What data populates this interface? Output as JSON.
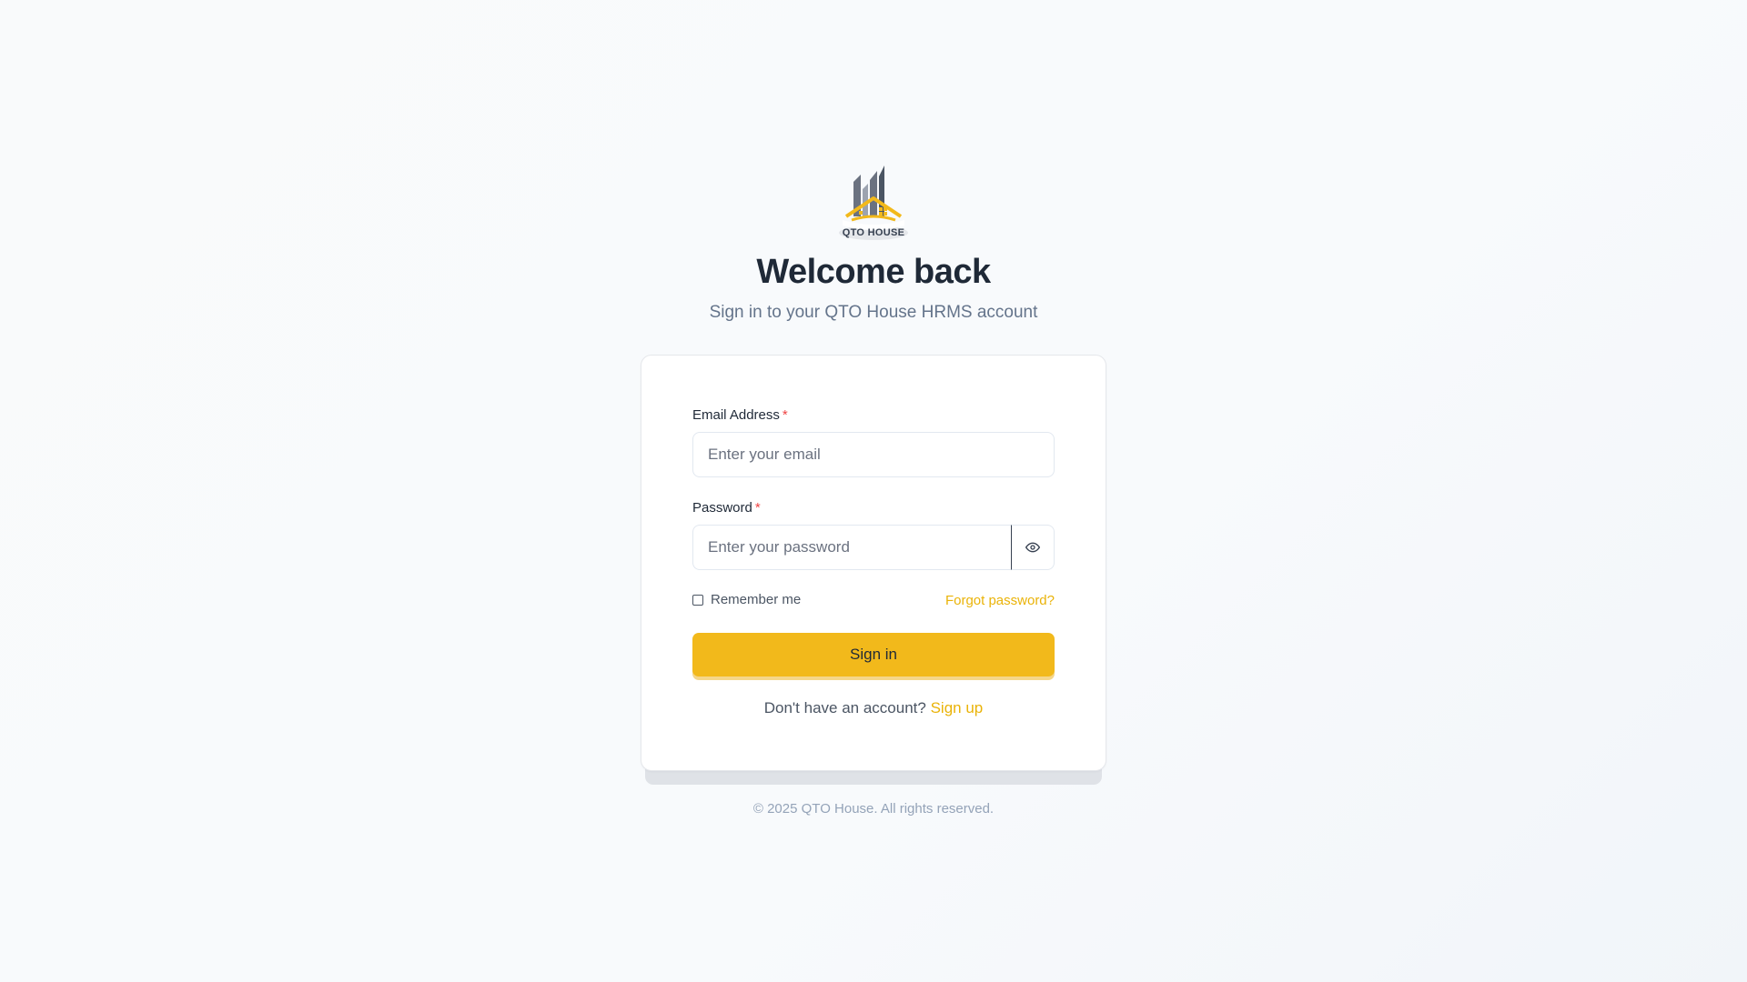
{
  "brand": {
    "logo_text": "QTO HOUSE",
    "accent_color": "#f2b91b",
    "link_color": "#eab308",
    "required_color": "#ef4444"
  },
  "header": {
    "title": "Welcome back",
    "subtitle": "Sign in to your QTO House HRMS account"
  },
  "form": {
    "email": {
      "label": "Email Address",
      "required_mark": "*",
      "placeholder": "Enter your email",
      "value": ""
    },
    "password": {
      "label": "Password",
      "required_mark": "*",
      "placeholder": "Enter your password",
      "value": "",
      "toggle_icon": "eye-icon"
    },
    "remember_label": "Remember me",
    "remember_checked": false,
    "forgot_label": "Forgot password?",
    "submit_label": "Sign in",
    "signup_prompt": "Don't have an account?",
    "signup_link": "Sign up"
  },
  "footer": {
    "copyright": "© 2025 QTO House. All rights reserved."
  }
}
